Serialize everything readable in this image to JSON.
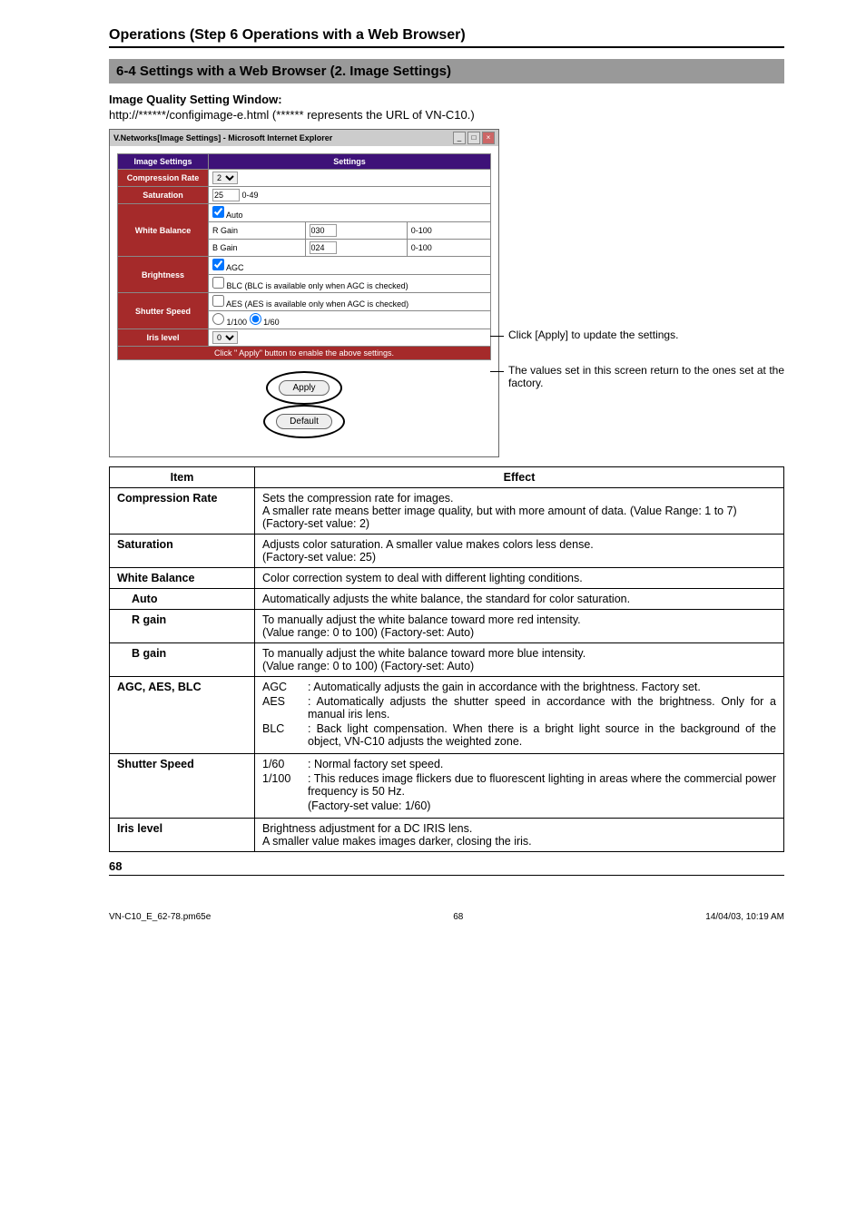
{
  "section_header": "Operations (Step 6 Operations with a Web Browser)",
  "subsection_header": "6-4 Settings with a Web Browser  (2. Image Settings)",
  "window_title": "Image Quality Setting Window:",
  "url_text": "http://******/configimage-e.html (****** represents the URL of VN-C10.)",
  "ie_window": {
    "titlebar": "V.Networks[Image Settings] - Microsoft Internet Explorer",
    "header_left": "Image Settings",
    "header_right": "Settings",
    "rows": {
      "compression_rate": {
        "label": "Compression Rate",
        "value": "2"
      },
      "saturation": {
        "label": "Saturation",
        "value": "25",
        "range": "0-49"
      },
      "white_balance": {
        "label": "White Balance",
        "auto_label": "Auto",
        "auto_checked": true,
        "r_gain_label": "R Gain",
        "r_gain_value": "030",
        "r_gain_range": "0-100",
        "b_gain_label": "B Gain",
        "b_gain_value": "024",
        "b_gain_range": "0-100"
      },
      "brightness": {
        "label": "Brightness",
        "agc_label": "AGC",
        "agc_checked": true,
        "blc_label": "BLC (BLC is available only when AGC is checked)",
        "blc_checked": false
      },
      "shutter_speed": {
        "label": "Shutter Speed",
        "aes_label": "AES (AES is available only when AGC is checked)",
        "aes_checked": false,
        "opt1": "1/100",
        "opt2": "1/60"
      },
      "iris_level": {
        "label": "Iris level",
        "value": "0"
      }
    },
    "instruction": "Click \" Apply\" button to enable the above settings.",
    "apply_btn": "Apply",
    "default_btn": "Default"
  },
  "annotations": {
    "apply": "Click [Apply] to update the settings.",
    "default": "The values set in this screen return to the ones set at the factory."
  },
  "main_table": {
    "header_item": "Item",
    "header_effect": "Effect",
    "rows": [
      {
        "item": "Compression Rate",
        "effect": "Sets the compression rate for images.\nA smaller rate means better image quality, but with more amount of data. (Value Range: 1 to 7) (Factory-set value: 2)"
      },
      {
        "item": "Saturation",
        "effect": "Adjusts color saturation. A smaller value makes colors less dense.\n(Factory-set value: 25)"
      },
      {
        "item": "White Balance",
        "effect": "Color correction system to deal with different lighting conditions."
      },
      {
        "item": "Auto",
        "sub": true,
        "effect": "Automatically adjusts the white balance, the standard for color saturation."
      },
      {
        "item": "R gain",
        "sub": true,
        "effect": "To manually adjust the white balance toward more red intensity.\n(Value range: 0 to 100) (Factory-set: Auto)"
      },
      {
        "item": "B gain",
        "sub": true,
        "effect": "To manually adjust the white balance toward more blue intensity.\n(Value range: 0 to 100) (Factory-set: Auto)"
      }
    ],
    "agc_row": {
      "item": "AGC, AES, BLC",
      "lines": [
        {
          "label": "AGC",
          "desc": ": Automatically adjusts the gain in accordance with the brightness.  Factory set."
        },
        {
          "label": "AES",
          "desc": ": Automatically adjusts the shutter speed in accordance with the brightness. Only for a manual iris lens."
        },
        {
          "label": "BLC",
          "desc": ": Back light compensation. When there is a bright light source in the background of the object, VN-C10 adjusts the weighted zone."
        }
      ]
    },
    "shutter_row": {
      "item": "Shutter Speed",
      "lines": [
        {
          "label": "1/60",
          "desc": ": Normal factory set speed."
        },
        {
          "label": "1/100",
          "desc": ": This reduces image flickers due to fluorescent lighting in areas where the commercial power frequency is 50 Hz."
        },
        {
          "label": "",
          "desc": "(Factory-set value: 1/60)"
        }
      ]
    },
    "iris_row": {
      "item": "Iris level",
      "effect": "Brightness adjustment for a DC IRIS lens.\nA smaller value makes images darker, closing the iris."
    }
  },
  "page_num": "68",
  "footer": {
    "left": "VN-C10_E_62-78.pm65e",
    "center": "68",
    "right": "14/04/03, 10:19 AM"
  }
}
